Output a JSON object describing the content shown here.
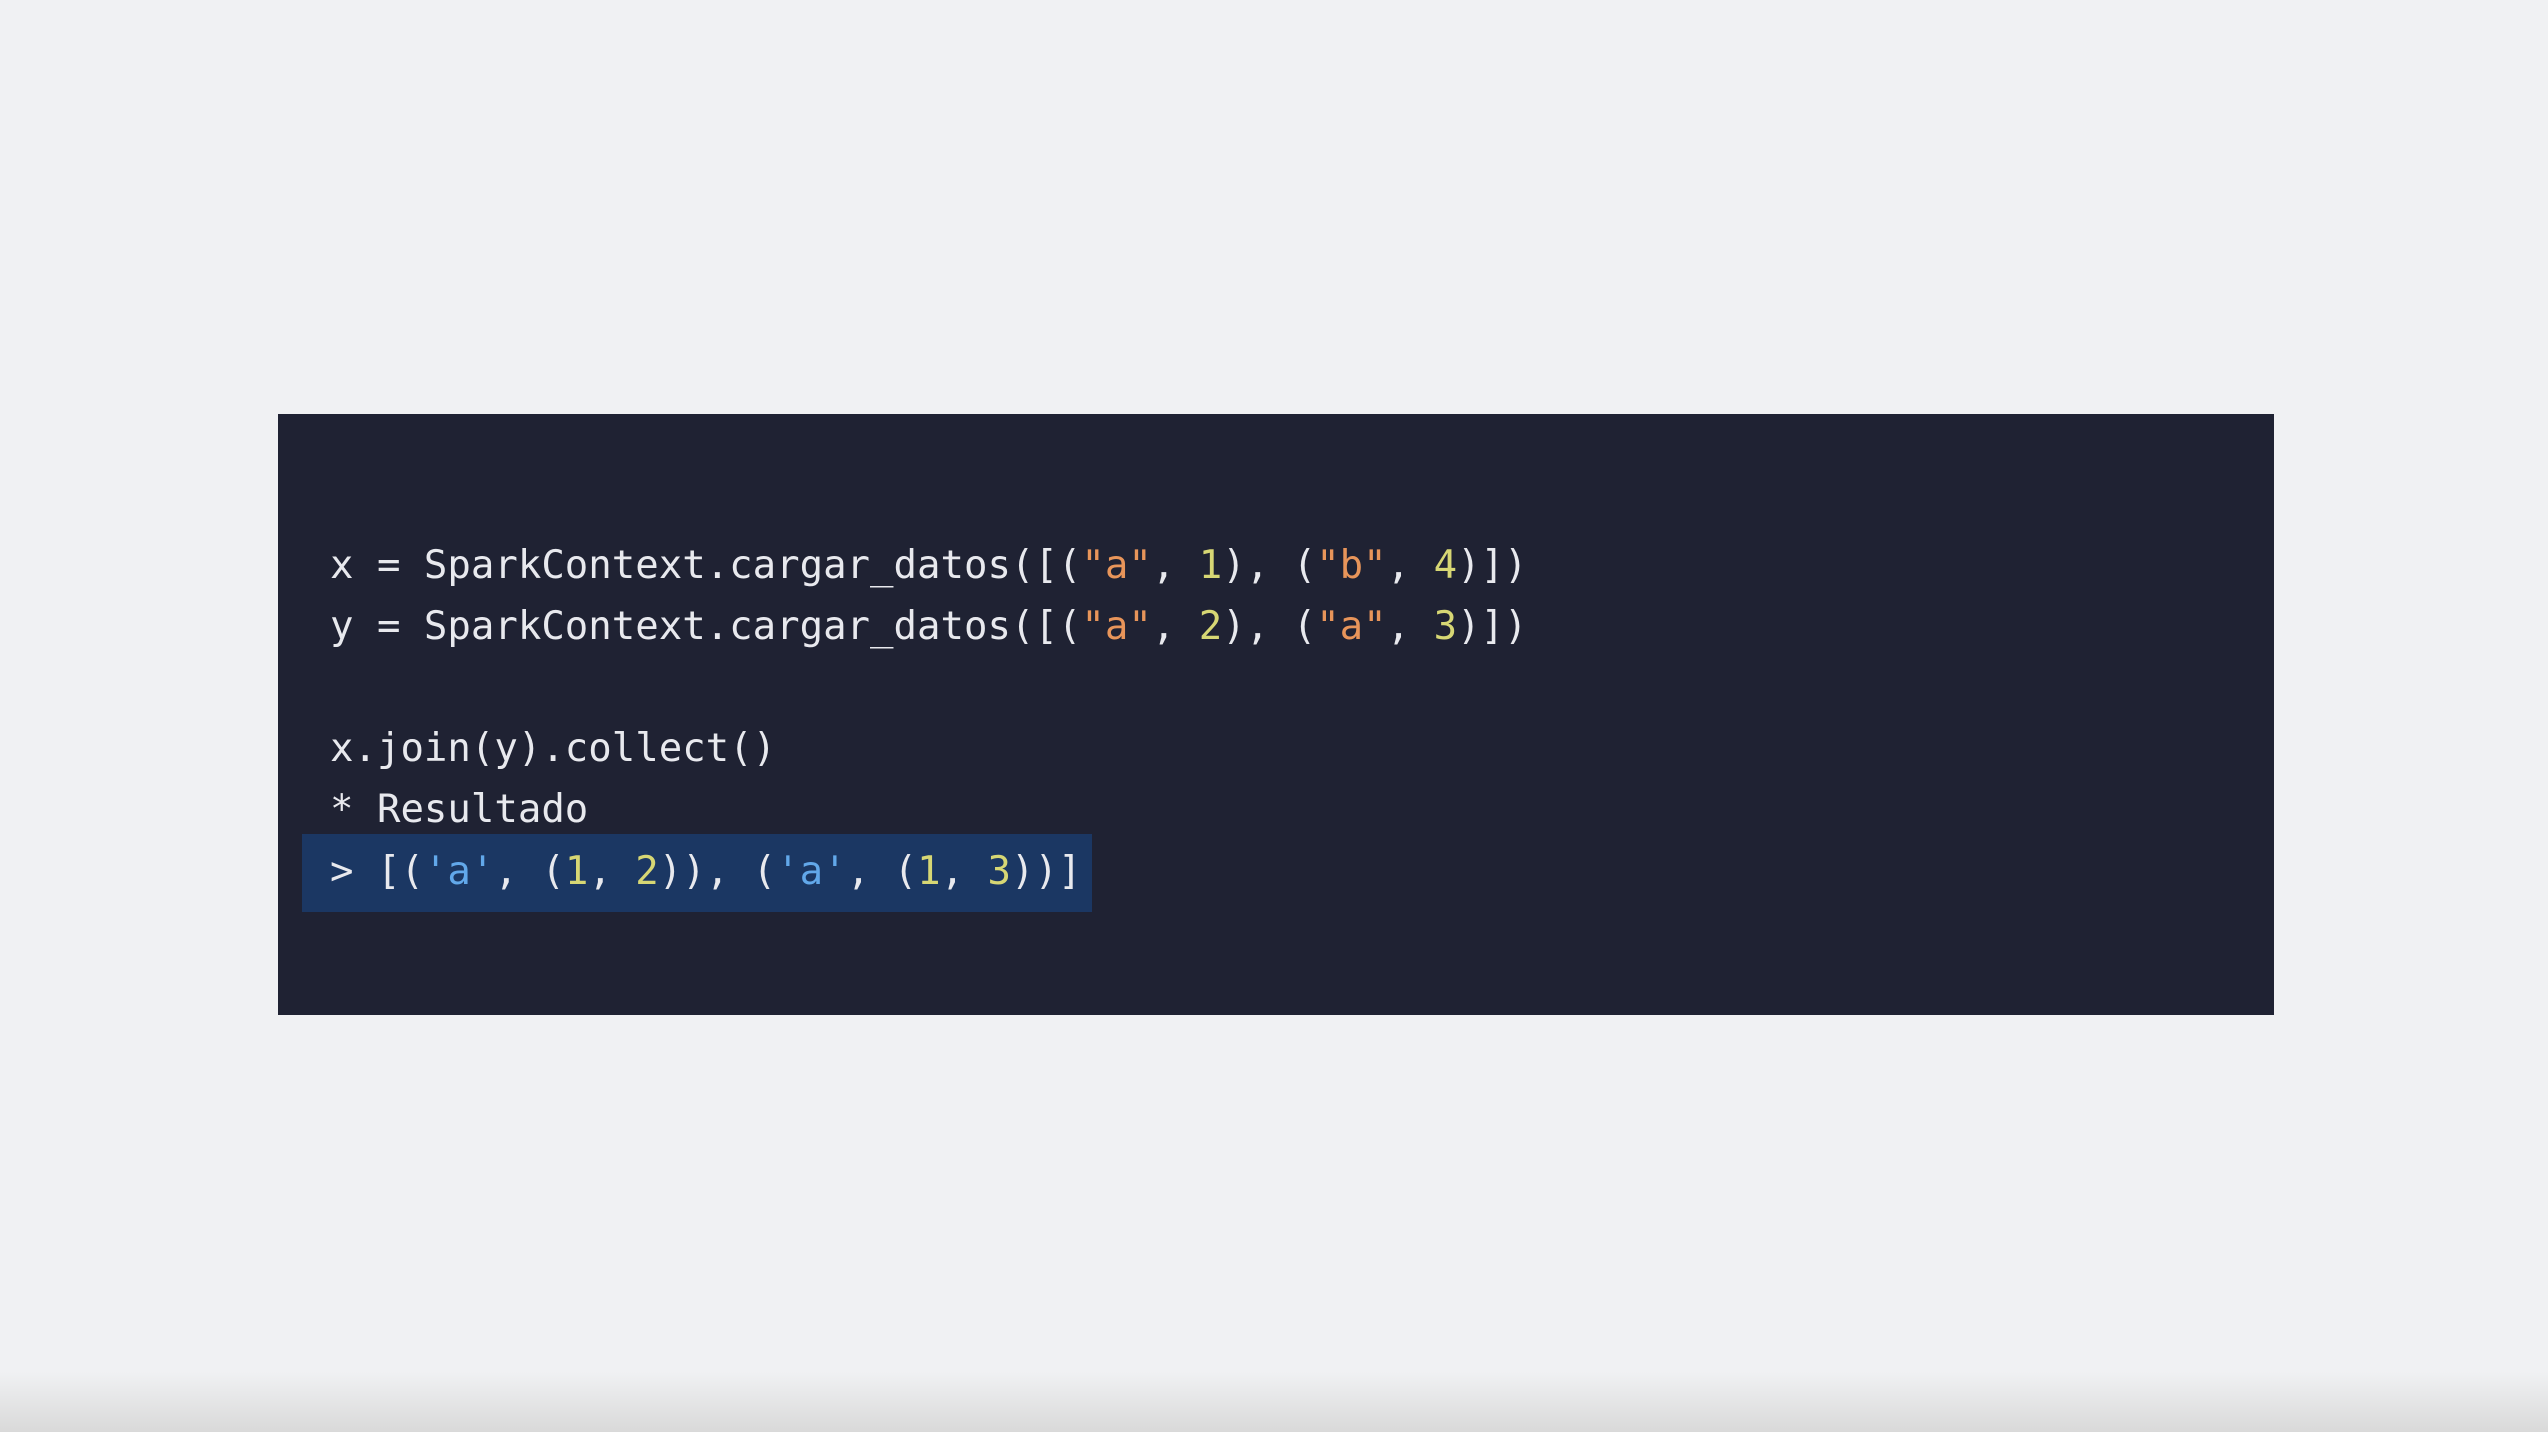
{
  "code": {
    "line1": {
      "prefix": "x = SparkContext.cargar_datos([(",
      "s1": "\"a\"",
      "sep1": ", ",
      "n1": "1",
      "mid": "), (",
      "s2": "\"b\"",
      "sep2": ", ",
      "n2": "4",
      "suffix": ")])"
    },
    "line2": {
      "prefix": "y = SparkContext.cargar_datos([(",
      "s1": "\"a\"",
      "sep1": ", ",
      "n1": "2",
      "mid": "), (",
      "s2": "\"a\"",
      "sep2": ", ",
      "n2": "3",
      "suffix": ")])"
    },
    "line3": "x.join(y).collect()",
    "line4": "* Resultado",
    "line5": {
      "prefix": "> [(",
      "s1": "'a'",
      "sep1": ", (",
      "n1": "1",
      "sep2": ", ",
      "n2": "2",
      "mid": ")), (",
      "s2": "'a'",
      "sep3": ", (",
      "n3": "1",
      "sep4": ", ",
      "n4": "3",
      "suffix": "))]"
    }
  }
}
